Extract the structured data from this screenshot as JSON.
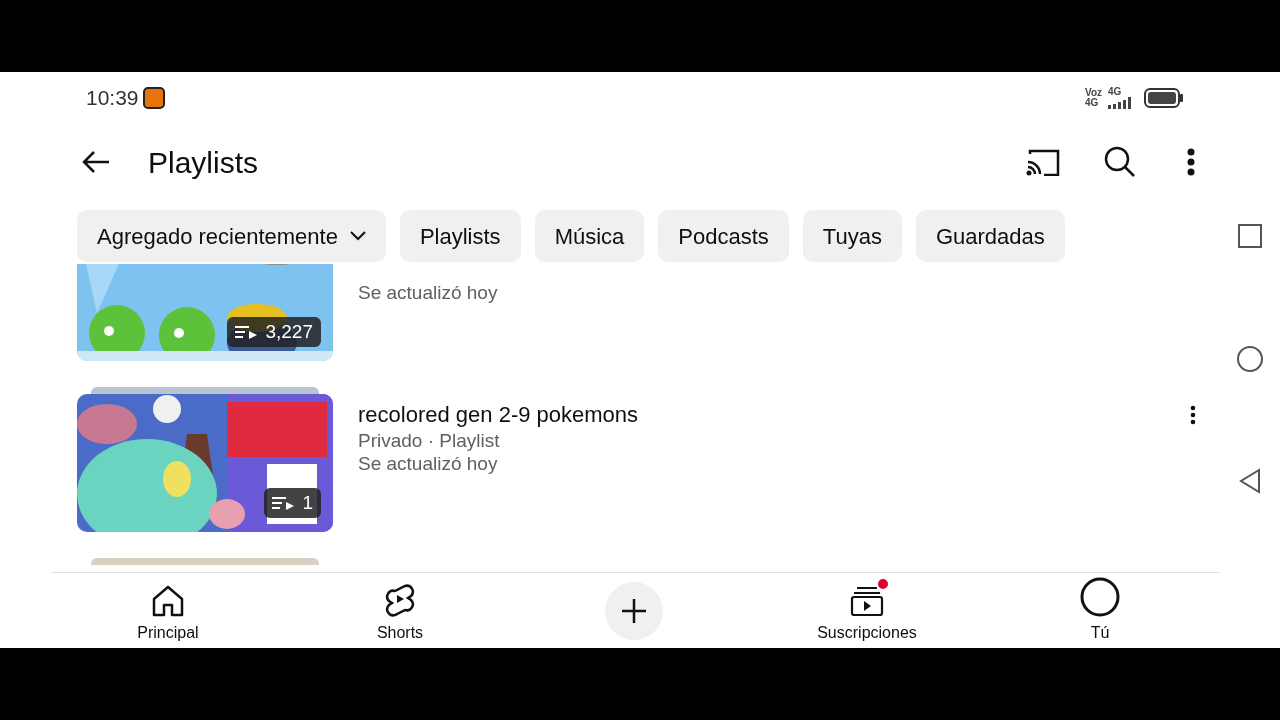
{
  "status_bar": {
    "time": "10:39",
    "network_labels": [
      "Voz",
      "4G"
    ],
    "signal_label": "4G"
  },
  "header": {
    "title": "Playlists"
  },
  "chips": [
    {
      "label": "Agregado recientemente",
      "kind": "dropdown"
    },
    {
      "label": "Playlists",
      "kind": "plain"
    },
    {
      "label": "Música",
      "kind": "plain"
    },
    {
      "label": "Podcasts",
      "kind": "plain"
    },
    {
      "label": "Tuyas",
      "kind": "plain"
    },
    {
      "label": "Guardadas",
      "kind": "plain"
    }
  ],
  "playlists": [
    {
      "updated": "Se actualizó hoy",
      "count": "3,227"
    },
    {
      "title": "recolored gen 2-9 pokemons",
      "meta": "Privado · Playlist",
      "updated": "Se actualizó hoy",
      "count": "1"
    }
  ],
  "bottom_nav": [
    {
      "kind": "home",
      "label": "Principal"
    },
    {
      "kind": "shorts",
      "label": "Shorts"
    },
    {
      "kind": "create"
    },
    {
      "kind": "subscriptions",
      "label": "Suscripciones",
      "badge": true
    },
    {
      "kind": "profile",
      "label": "Tú"
    }
  ]
}
